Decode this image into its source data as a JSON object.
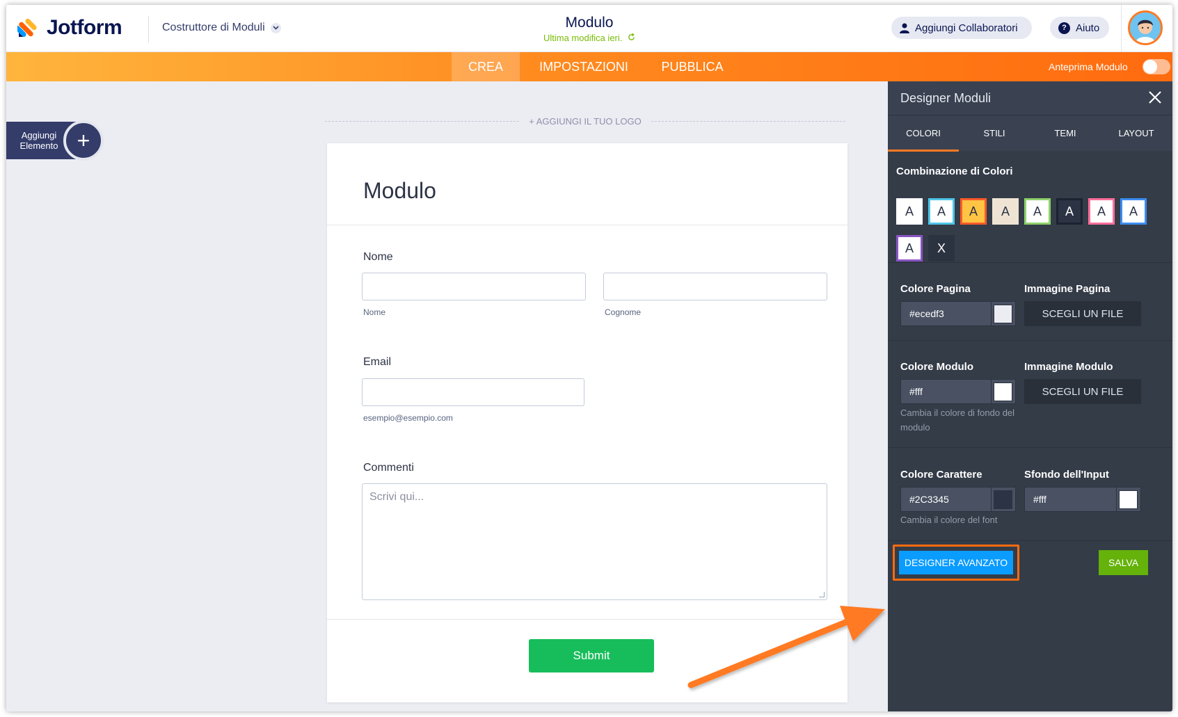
{
  "header": {
    "brand": "Jotform",
    "builder_label": "Costruttore di Moduli",
    "form_title": "Modulo",
    "last_modified": "Ultima modifica ieri.",
    "add_collaborators": "Aggiungi Collaboratori",
    "help": "Aiuto"
  },
  "nav": {
    "tabs": [
      {
        "label": "CREA",
        "active": true
      },
      {
        "label": "IMPOSTAZIONI",
        "active": false
      },
      {
        "label": "PUBBLICA",
        "active": false
      }
    ],
    "preview_label": "Anteprima Modulo"
  },
  "sidebar": {
    "add_element_label": "Aggiungi Elemento",
    "plus": "+"
  },
  "form": {
    "logo_placeholder": "+ AGGIUNGI IL TUO LOGO",
    "title": "Modulo",
    "name_label": "Nome",
    "first_name_sub": "Nome",
    "last_name_sub": "Cognome",
    "email_label": "Email",
    "email_sub": "esempio@esempio.com",
    "comments_label": "Commenti",
    "comments_placeholder": "Scrivi qui...",
    "submit": "Submit"
  },
  "panel": {
    "title": "Designer Moduli",
    "tabs": [
      "COLORI",
      "STILI",
      "TEMI",
      "LAYOUT"
    ],
    "active_tab": "COLORI",
    "color_schemes_label": "Combinazione di Colori",
    "schemes": [
      {
        "letter": "A",
        "bg": "#ffffff",
        "fg": "#2c3345",
        "border": "#ffffff"
      },
      {
        "letter": "A",
        "bg": "#ffffff",
        "fg": "#2c3345",
        "border": "#4ec6e6"
      },
      {
        "letter": "A",
        "bg": "#ffc444",
        "fg": "#2c3345",
        "border": "#ff5a2a"
      },
      {
        "letter": "A",
        "bg": "#efe4d4",
        "fg": "#2c3345",
        "border": "#efe4d4"
      },
      {
        "letter": "A",
        "bg": "#ffffff",
        "fg": "#2c3345",
        "border": "#8ed26a"
      },
      {
        "letter": "A",
        "bg": "#2c3345",
        "fg": "#ffffff",
        "border": "#1c2230"
      },
      {
        "letter": "A",
        "bg": "#ffffff",
        "fg": "#2c3345",
        "border": "#ff6f9c"
      },
      {
        "letter": "A",
        "bg": "#ffffff",
        "fg": "#2c3345",
        "border": "#3c8df0"
      },
      {
        "letter": "A",
        "bg": "#ffffff",
        "fg": "#2c3345",
        "border": "#8a55c4"
      },
      {
        "letter": "X",
        "bg": "#2c3340",
        "fg": "#ffffff",
        "border": "#2c3340"
      }
    ],
    "page_color_label": "Colore Pagina",
    "page_color_value": "#ecedf3",
    "page_image_label": "Immagine Pagina",
    "choose_file": "SCEGLI UN FILE",
    "form_color_label": "Colore Modulo",
    "form_color_value": "#fff",
    "form_image_label": "Immagine Modulo",
    "form_color_help": "Cambia il colore di fondo del modulo",
    "font_color_label": "Colore Carattere",
    "font_color_value": "#2C3345",
    "font_color_help": "Cambia il colore del font",
    "input_bg_label": "Sfondo dell'Input",
    "input_bg_value": "#fff",
    "advanced_designer": "DESIGNER AVANZATO",
    "save": "SALVA"
  },
  "colors": {
    "brand_navy": "#0a1551",
    "orange": "#ff7a22",
    "submit_green": "#18bd5b",
    "panel_bg": "#343c48",
    "advanced_blue": "#0a9cff",
    "save_green": "#64b20a"
  }
}
